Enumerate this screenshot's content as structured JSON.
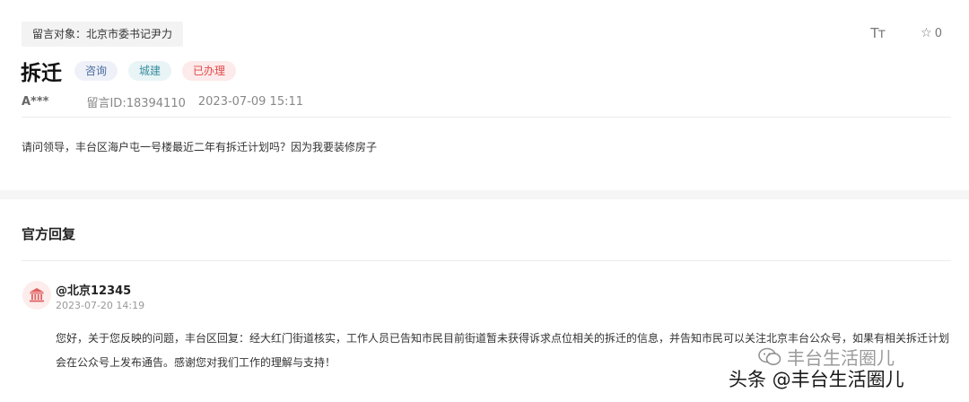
{
  "header": {
    "target_tag": "留言对象：北京市委书记尹力",
    "font_tool": "Tт",
    "favorite_count": "0"
  },
  "message": {
    "title": "拆迁",
    "tags": [
      "咨询",
      "城建",
      "已办理"
    ],
    "user": "A***",
    "message_id": "留言ID:18394110",
    "datetime": "2023-07-09 15:11",
    "content": "请问领导，丰台区海户屯一号楼最近二年有拆迁计划吗？因为我要装修房子"
  },
  "reply": {
    "section_title": "官方回复",
    "author": "@北京12345",
    "datetime": "2023-07-20 14:19",
    "content": "您好，关于您反映的问题，丰台区回复：经大红门街道核实，工作人员已告知市民目前街道暂未获得诉求点位相关的拆迁的信息，并告知市民可以关注北京丰台公众号，如果有相关拆迁计划会在公众号上发布通告。感谢您对我们工作的理解与支持！"
  },
  "watermark": {
    "wechat_name": "丰台生活圈儿",
    "toutiao_text": "头条 @丰台生活圈儿"
  },
  "colors": {
    "tag_blue": "#4b6aa0",
    "tag_teal": "#3a8fa0",
    "tag_red": "#e04a4a",
    "avatar_red": "#e06060"
  },
  "icons": [
    "font-size-icon",
    "star-icon",
    "government-building-icon",
    "wechat-icon"
  ]
}
